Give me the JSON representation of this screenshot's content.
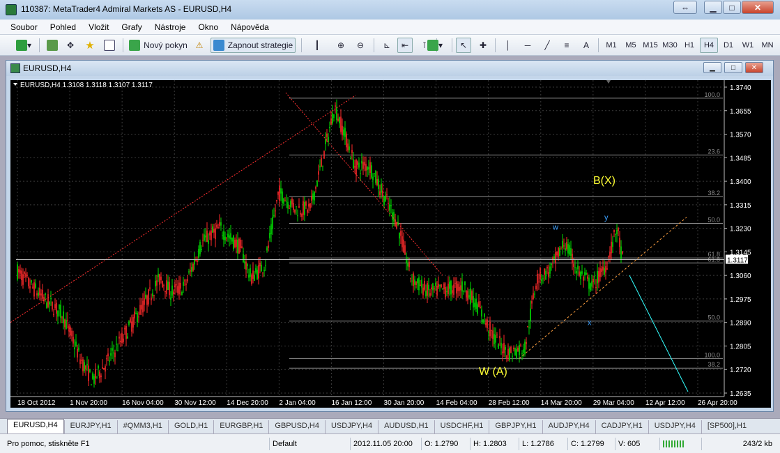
{
  "window": {
    "title": "110387: MetaTrader4 Admiral Markets AS - EURUSD,H4",
    "restore_glyph": "⇔",
    "min_glyph": "▁",
    "max_glyph": "□",
    "close_glyph": "✕"
  },
  "menu": [
    "Soubor",
    "Pohled",
    "Vložit",
    "Grafy",
    "Nástroje",
    "Okno",
    "Nápověda"
  ],
  "toolbar": {
    "new_order": "Nový pokyn",
    "strategy": "Zapnout strategie",
    "timeframes": [
      "M1",
      "M5",
      "M15",
      "M30",
      "H1",
      "H4",
      "D1",
      "W1",
      "MN"
    ],
    "active_tf": "H4",
    "text_tool": "A"
  },
  "chart_window": {
    "title": "EURUSD,H4"
  },
  "chart_header": "EURUSD,H4  1.3108 1.3118 1.3107 1.3117",
  "current_price": "1.3117",
  "price_labels": [
    "1.3740",
    "1.3655",
    "1.3570",
    "1.3485",
    "1.3400",
    "1.3315",
    "1.3230",
    "1.3145",
    "1.3060",
    "1.2975",
    "1.2890",
    "1.2805",
    "1.2720",
    "1.2635"
  ],
  "time_labels": [
    "18 Oct 2012",
    "1 Nov 20:00",
    "16 Nov 04:00",
    "30 Nov 12:00",
    "14 Dec 20:00",
    "2 Jan 04:00",
    "16 Jan 12:00",
    "30 Jan 20:00",
    "14 Feb 04:00",
    "28 Feb 12:00",
    "14 Mar 20:00",
    "29 Mar 04:00",
    "12 Apr 12:00",
    "26 Apr 20:00"
  ],
  "fib_labels": [
    "100.0",
    "23.6",
    "38.2",
    "50.0",
    "61.8",
    "61.8",
    "50.0",
    "100.0",
    "38.2"
  ],
  "annotations": {
    "wave_b": "B(X)",
    "wave_w": "W (A)",
    "w": "w",
    "x": "x",
    "y": "y"
  },
  "colors": {
    "bull": "#00e000",
    "bear": "#ff2a2a",
    "fib": "#8c8c8c",
    "wave_label": "#ffff33",
    "wxy": "#3aa0ff",
    "channel": "#ffa040",
    "cyan_line": "#33ffff"
  },
  "tabs": [
    "EURUSD,H4",
    "EURJPY,H1",
    "#QMM3,H1",
    "GOLD,H1",
    "EURGBP,H1",
    "GBPUSD,H4",
    "USDJPY,H4",
    "AUDUSD,H1",
    "USDCHF,H1",
    "GBPJPY,H1",
    "AUDJPY,H4",
    "CADJPY,H1",
    "USDJPY,H4",
    "[SP500],H1"
  ],
  "status": {
    "help": "Pro pomoc, stiskněte F1",
    "profile": "Default",
    "datetime": "2012.11.05 20:00",
    "open": "O: 1.2790",
    "high": "H: 1.2803",
    "low": "L: 1.2786",
    "close": "C: 1.2799",
    "volume": "V: 605",
    "traffic": "243/2 kb"
  }
}
